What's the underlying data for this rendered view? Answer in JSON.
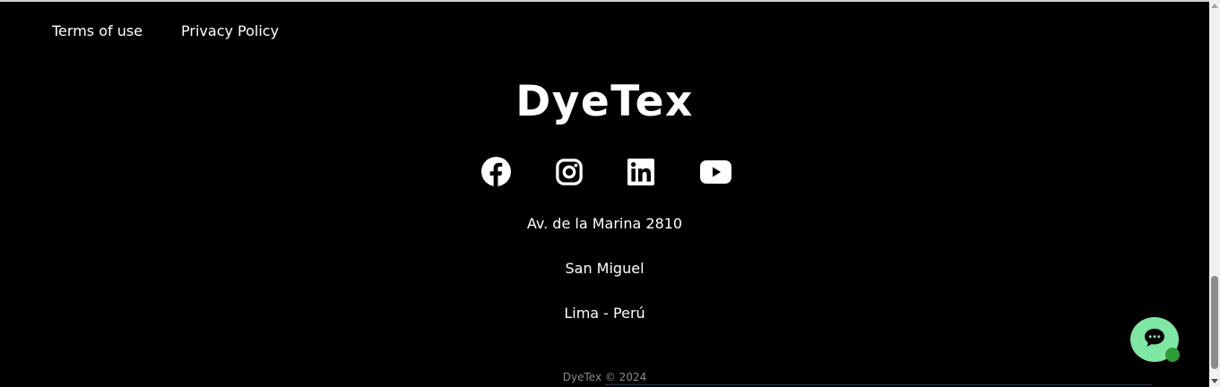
{
  "footer": {
    "legal_links": [
      {
        "label": "Terms of use"
      },
      {
        "label": "Privacy Policy"
      }
    ],
    "brand_name": "DyeTex",
    "social_icons": [
      "facebook-icon",
      "instagram-icon",
      "linkedin-icon",
      "youtube-icon"
    ],
    "address": {
      "line1": "Av. de la Marina 2810",
      "line2": "San Miguel",
      "line3": "Lima - Perú"
    },
    "copyright": "DyeTex © 2024"
  },
  "chat_widget": {
    "icon": "chat-bubble-icon",
    "color": "#7fe6a3",
    "status_color": "#2e9a3a"
  },
  "colors": {
    "background": "#000000",
    "text": "#ffffff",
    "copyright_text": "#8a8a8a"
  }
}
